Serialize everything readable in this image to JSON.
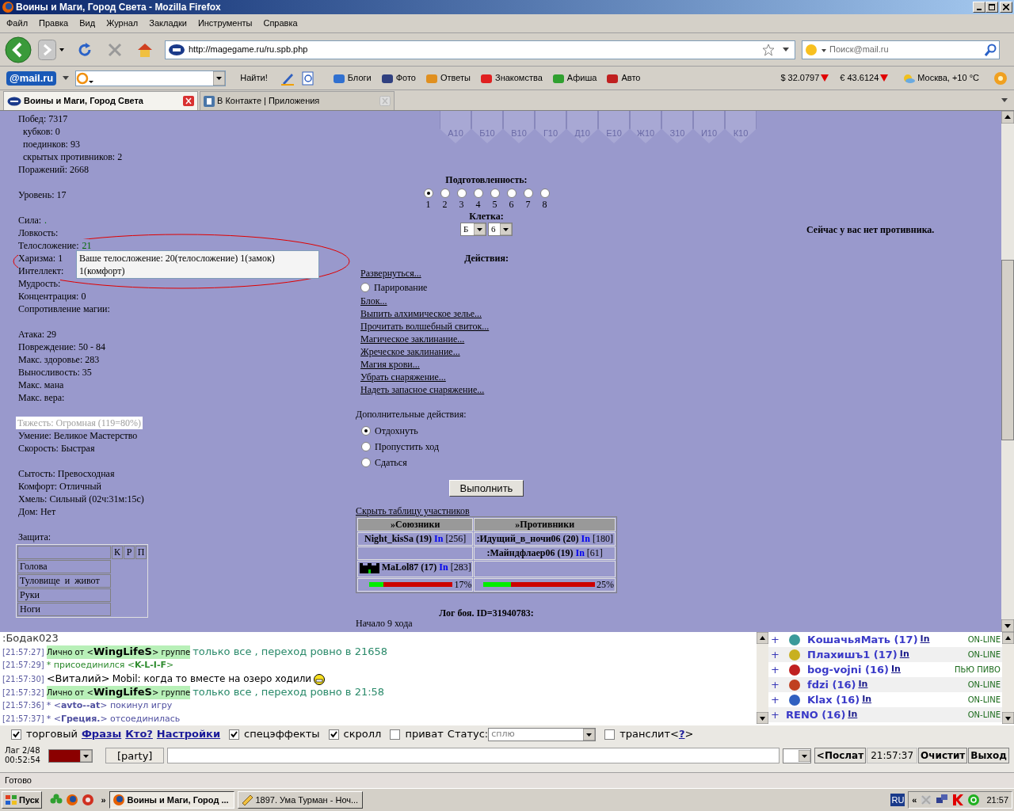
{
  "window": {
    "title": "Воины и Маги, Город Света - Mozilla Firefox"
  },
  "menu": [
    "Файл",
    "Правка",
    "Вид",
    "Журнал",
    "Закладки",
    "Инструменты",
    "Справка"
  ],
  "navigation": {
    "url": "http://magegame.ru/ru.spb.php",
    "search_placeholder": "Поиск@mail.ru"
  },
  "mail_toolbar": {
    "logo": "@mail.ru",
    "find_button": "Найти!",
    "links": [
      "Блоги",
      "Фото",
      "Ответы",
      "Знакомства",
      "Афиша",
      "Авто"
    ],
    "usd": "$ 32.0797",
    "eur": "€ 43.6124",
    "weather": "Москва, +10 °C"
  },
  "tabs": [
    {
      "label": "Воины и Маги, Город Света",
      "selected": true
    },
    {
      "label": "В Контакте | Приложения",
      "selected": false
    }
  ],
  "stats": [
    [
      {
        "label": "Побед: 7317",
        "children": [
          {
            "label": "кубков: 0"
          },
          {
            "label": "поединков: 93"
          },
          {
            "label": "скрытых противников: 2"
          }
        ]
      },
      {
        "label": "Поражений: 2668"
      }
    ],
    [
      {
        "label": "Уровень: 17"
      }
    ],
    [
      {
        "label": "Сила: ",
        "value": "."
      },
      {
        "label": "Ловкость:"
      },
      {
        "label": "Телосложение: ",
        "value": "21"
      },
      {
        "label": "Харизма: 1"
      },
      {
        "label": "Интеллект:"
      },
      {
        "label": "Мудрость:"
      },
      {
        "label": "Концентрация: 0"
      },
      {
        "label": "Сопротивление магии:"
      }
    ],
    [
      {
        "label": "Атака: 29"
      },
      {
        "label": "Повреждение: 50 - 84"
      },
      {
        "label": "Макс. здоровье: 283"
      },
      {
        "label": "Выносливость: 35"
      },
      {
        "label": "Макс. мана"
      },
      {
        "label": "Макс. вера:"
      }
    ],
    [
      {
        "label": "Тяжесть: Огромная (119=80%)",
        "kind": "boxed"
      },
      {
        "label": "Умение: Великое Мастерство"
      },
      {
        "label": "Скорость: Быстрая"
      }
    ],
    [
      {
        "label": "Сытость: Превосходная"
      },
      {
        "label": "Комфорт: Отличный"
      },
      {
        "label": "Хмель: Сильный (02ч:31м:15с)"
      },
      {
        "label": "Дом: Нет"
      }
    ]
  ],
  "tooltip": {
    "text": "Ваше телосложение: 20(телосложение) 1(замок) 1(комфорт)"
  },
  "defense": {
    "title": "Защита:",
    "columns": [
      "К",
      "Р",
      "П"
    ],
    "rows": [
      "Голова",
      "Туловище  и  живот",
      "Руки",
      "Ноги"
    ]
  },
  "hex_cells": [
    "А10",
    "Б10",
    "В10",
    "Г10",
    "Д10",
    "Е10",
    "Ж10",
    "З10",
    "И10",
    "К10"
  ],
  "readiness": {
    "title": "Подготовленность:",
    "options": [
      {
        "label": "1",
        "selected": true
      },
      {
        "label": "2",
        "selected": false
      },
      {
        "label": "3",
        "selected": false
      },
      {
        "label": "4",
        "selected": false
      },
      {
        "label": "5",
        "selected": false
      },
      {
        "label": "6",
        "selected": false
      },
      {
        "label": "7",
        "selected": false
      },
      {
        "label": "8",
        "selected": false
      }
    ]
  },
  "cell": {
    "title": "Клетка:",
    "column": "Б",
    "row": "6"
  },
  "actions": {
    "title": "Действия:",
    "items": [
      {
        "kind": "link",
        "label": "Развернуться..."
      },
      {
        "kind": "radio",
        "label": "Парирование",
        "selected": false
      },
      {
        "kind": "link",
        "label": "Блок..."
      },
      {
        "kind": "link",
        "label": "Выпить алхимическое зелье..."
      },
      {
        "kind": "link",
        "label": "Прочитать волшебный свиток..."
      },
      {
        "kind": "link",
        "label": "Магическое заклинание..."
      },
      {
        "kind": "link",
        "label": "Жреческое заклинание..."
      },
      {
        "kind": "link",
        "label": "Магия крови..."
      },
      {
        "kind": "link",
        "label": "Убрать снаряжение..."
      },
      {
        "kind": "link",
        "label": "Надеть запасное снаряжение..."
      }
    ]
  },
  "extra_actions": {
    "title": "Дополнительные действия:",
    "options": [
      {
        "label": "Отдохнуть",
        "selected": true
      },
      {
        "label": "Пропустить ход",
        "selected": false
      },
      {
        "label": "Сдаться",
        "selected": false
      }
    ]
  },
  "submit_button": "Выполнить",
  "opponent_notice": "Сейчас у вас нет противника.",
  "participants": {
    "toggle_link": "Скрыть таблицу участников",
    "columns": [
      "»Союзники",
      "»Противники"
    ],
    "rows": [
      [
        {
          "name": "Night_kisSa (19)",
          "link": "In",
          "hp": "[256]",
          "emblem": false
        },
        {
          "name": ":Идущий_в_ночи06 (20)",
          "link": "In",
          "hp": "[180]",
          "emblem": false
        }
      ],
      [
        null,
        {
          "name": ":Майндфлаер06 (19)",
          "link": "In",
          "hp": "[61]",
          "emblem": false
        }
      ],
      [
        {
          "name": "MaLol87 (17)",
          "link": "In",
          "hp": "[283]",
          "emblem": true
        },
        null
      ]
    ],
    "health": [
      {
        "level": 0.17,
        "reading": "17%"
      },
      {
        "level": 0.25,
        "reading": "25%"
      }
    ]
  },
  "battle_log": {
    "title": "Лог боя. ID=31940783:",
    "lines": [
      "Начало 9 хода"
    ]
  },
  "chat": [
    {
      "kind": "plain",
      "text": ":Бодак023"
    },
    {
      "kind": "private",
      "time": "[21:57:27]",
      "before": "Лично от <",
      "sender": "WingLifeS",
      "after": "> группе",
      "text": "только все , переход ровно в 21658"
    },
    {
      "kind": "system",
      "time": "[21:57:29]",
      "text": "* присоединился <**K-L-I-F**>",
      "color": "#2e8b2e"
    },
    {
      "kind": "say",
      "time": "[21:57:30]",
      "sender": "<Виталий>",
      "text": "Mobil: когда то вместе на озеро ходили",
      "smiley": true
    },
    {
      "kind": "private",
      "time": "[21:57:32]",
      "before": "Лично от <",
      "sender": "WingLifeS",
      "after": "> группе",
      "text": "только все , переход ровно в 21:58"
    },
    {
      "kind": "system",
      "time": "[21:57:36]",
      "text": "* <**avto--at**> покинул игру",
      "color": "#5050a0"
    },
    {
      "kind": "system",
      "time": "[21:57:37]",
      "text": "* <**Греция.**> отсоединилась",
      "color": "#5050a0"
    }
  ],
  "online": [
    {
      "toggle": "+",
      "name": "КошачьяМать (17)",
      "link": "In",
      "status": "ON-LINE",
      "emblem": true
    },
    {
      "toggle": "+",
      "name": "Плахишъ1 (17)",
      "link": "In",
      "status": "ON-LINE",
      "emblem": true
    },
    {
      "toggle": "+",
      "name": "bog-vojni (16)",
      "link": "In",
      "status": "ПЬЮ ПИВО",
      "emblem": true
    },
    {
      "toggle": "+",
      "name": "fdzi (16)",
      "link": "In",
      "status": "ON-LINE",
      "emblem": true
    },
    {
      "toggle": "+",
      "name": "Klax (16)",
      "link": "In",
      "status": "ON-LINE",
      "emblem": true
    },
    {
      "toggle": "+",
      "name": "RENO (16)",
      "link": "In",
      "status": "ON-LINE",
      "emblem": false
    }
  ],
  "chat_options": [
    {
      "kind": "checkbox",
      "label": "торговый",
      "checked": true
    },
    {
      "kind": "link",
      "label": "Фразы"
    },
    {
      "kind": "link",
      "label": "Кто?"
    },
    {
      "kind": "link",
      "label": "Настройки"
    },
    {
      "kind": "checkbox",
      "label": "спецэффекты",
      "checked": true
    },
    {
      "kind": "checkbox",
      "label": "скролл",
      "checked": true
    },
    {
      "kind": "checkbox",
      "label": "приват",
      "checked": false
    },
    {
      "kind": "select",
      "label": "Статус:",
      "value": "сплю"
    },
    {
      "kind": "checkbox",
      "label": "транслит<",
      "checked": false,
      "link": "?",
      "after": ">"
    }
  ],
  "input_bar": {
    "lag": "Лаг 2/48",
    "clock": "00:52:54",
    "party_button": "[party]",
    "send_button": "<Послат",
    "time": "21:57:37",
    "clear_button": "Очистит",
    "exit_button": "Выход"
  },
  "status_bar": "Готово",
  "taskbar": {
    "start": "Пуск",
    "chevron": "»",
    "tasks": [
      {
        "label": "Воины и Маги, Город ...",
        "selected": true
      },
      {
        "label": "1897. Ума Турман - Ноч...",
        "selected": false
      }
    ],
    "language": "RU",
    "tray_chevron": "«",
    "clock": "21:57"
  }
}
